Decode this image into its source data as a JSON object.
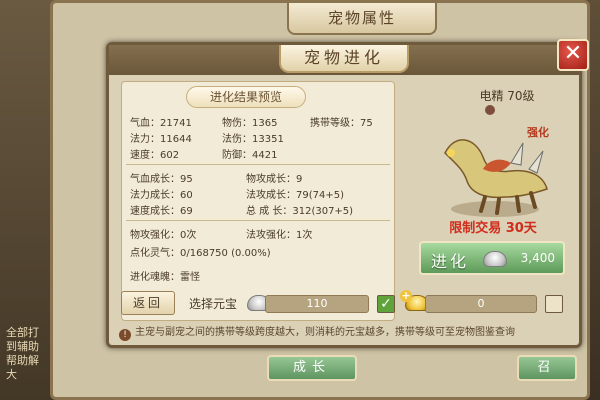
{
  "outer_window": {
    "title": "宠物属性",
    "bottom_buttons": [
      "成长",
      "召"
    ]
  },
  "dialog": {
    "title": "宠物进化",
    "close_symbol": "✕",
    "preview_title": "进化结果预览",
    "stats_base": {
      "hp": "气血：21741",
      "phys_atk": "物伤：1365",
      "carry_level": "携带等级：75",
      "mp": "法力：11644",
      "magic_atk": "法伤：13351",
      "speed": "速度：602",
      "defense": "防御：4421"
    },
    "stats_growth": {
      "hp_growth": "气血成长：95",
      "phys_growth": "物攻成长：9",
      "mp_growth": "法力成长：60",
      "magic_growth": "法攻成长：79(74+5)",
      "speed_growth": "速度成长：69",
      "total_growth": "总 成 长：312(307+5)"
    },
    "enhance": {
      "phys": "物攻强化：0次",
      "magic": "法攻强化：1次",
      "spirit": "点化灵气：0/168750 (0.00%)",
      "soul": "进化魂魄：雷怪"
    },
    "pet": {
      "name": "电精 70级",
      "tag": "强化",
      "trade_limit": "限制交易 30天"
    },
    "evolve": {
      "label": "进化",
      "cost": "3,400"
    },
    "bottom": {
      "return": "返回",
      "select_ingot": "选择元宝",
      "silver_amount": "110",
      "gold_amount": "0"
    },
    "notice": "主宠与副宠之间的携带等级跨度越大，则消耗的元宝越多，携带等级可至宠物图鉴查询"
  },
  "background": {
    "side_text": [
      "全部打",
      "到辅助",
      "帮助解",
      "大"
    ]
  },
  "colors": {
    "accent_green": "#5d9a58",
    "warning_red": "#d02b1b",
    "frame_brown": "#6f5b3c"
  },
  "icons": [
    "close-icon",
    "silver-ingot-icon",
    "gold-ingot-icon",
    "check-icon",
    "info-icon"
  ]
}
